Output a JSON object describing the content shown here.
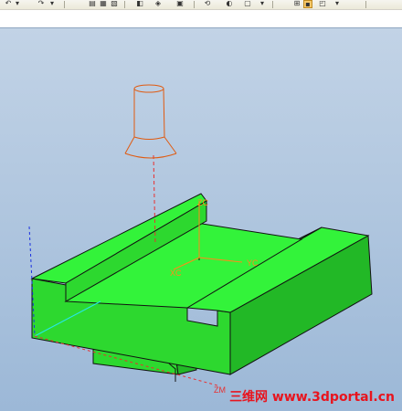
{
  "toolbar": {
    "icons": [
      "undo-icon",
      "redo-icon",
      "dropdown-icon",
      "copy-icon",
      "snap-icon",
      "document-icon",
      "layer-icon",
      "print-icon",
      "view-icon",
      "rotate-icon",
      "display-icon",
      "dropdown-icon",
      "check-icon",
      "active-view-icon",
      "more-icon"
    ]
  },
  "viewport": {
    "axis_labels": {
      "zc": "ZC",
      "yc": "YC",
      "xc": "XC",
      "zm": "ZM"
    }
  },
  "watermark": "三维网 www.3dportal.cn",
  "colors": {
    "part_top": "#33f33a",
    "part_front": "#2dd82f",
    "part_side": "#22b826",
    "tool": "#e05a10",
    "tool_axis": "#e83030",
    "datum": "#ff8a1a"
  }
}
